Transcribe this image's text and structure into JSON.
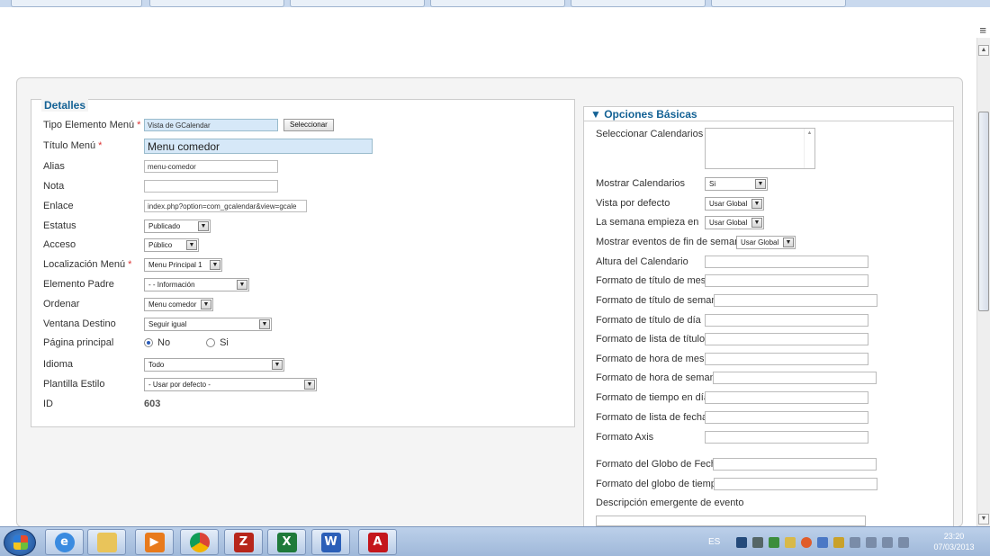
{
  "browser": {
    "menu_glyph": "≡"
  },
  "details": {
    "legend": "Detalles",
    "tipo_label": "Tipo Elemento Menú",
    "tipo_value": "Vista de GCalendar",
    "seleccionar_button": "Seleccionar",
    "titulo_label": "Título Menú",
    "titulo_value": "Menu comedor",
    "alias_label": "Alias",
    "alias_value": "menu-comedor",
    "nota_label": "Nota",
    "nota_value": "",
    "enlace_label": "Enlace",
    "enlace_value": "index.php?option=com_gcalendar&view=gcale",
    "estatus_label": "Estatus",
    "estatus_value": "Publicado",
    "acceso_label": "Acceso",
    "acceso_value": "Público",
    "localizacion_label": "Localización Menú",
    "localizacion_value": "Menu Principal 1",
    "padre_label": "Elemento Padre",
    "padre_value": "- - Información",
    "ordenar_label": "Ordenar",
    "ordenar_value": "Menu comedor",
    "ventana_label": "Ventana Destino",
    "ventana_value": "Seguir igual",
    "principal_label": "Página principal",
    "principal_no": "No",
    "principal_si": "Si",
    "principal_selected": "No",
    "idioma_label": "Idioma",
    "idioma_value": "Todo",
    "plantilla_label": "Plantilla Estilo",
    "plantilla_value": "- Usar por defecto -",
    "id_label": "ID",
    "id_value": "603",
    "required_mark": "*"
  },
  "options": {
    "title": "▼ Opciones Básicas",
    "calendarios_label": "Seleccionar Calendarios",
    "mostrar_cal_label": "Mostrar Calendarios",
    "mostrar_cal_value": "Si",
    "vista_label": "Vista por defecto",
    "vista_value": "Usar Global",
    "semana_label": "La semana empieza en",
    "semana_value": "Usar Global",
    "finde_label": "Mostrar eventos de fin de semana",
    "finde_value": "Usar Global",
    "altura_label": "Altura del Calendario",
    "titulo_mes_label": "Formato de título de mes",
    "titulo_semana_label": "Formato de título de semana",
    "titulo_dia_label": "Formato de título de día",
    "lista_titulo_label": "Formato de lista de título",
    "hora_mes_label": "Formato de hora de mes",
    "hora_semana_label": "Formato de hora de semana",
    "tiempo_dia_label": "Formato de tiempo en día",
    "lista_fecha_label": "Formato de lista de fecha",
    "axis_label": "Formato Axis",
    "globo_fecha_label": "Formato del Globo de Fecha",
    "globo_tiempo_label": "Formato del globo de tiempo",
    "descripcion_label": "Descripción emergente de evento"
  },
  "taskbar": {
    "lang": "ES",
    "time": "23:20",
    "date": "07/03/2013",
    "apps": [
      "internet-explorer",
      "file-explorer",
      "media-player",
      "chrome",
      "filezilla",
      "excel",
      "word",
      "acrobat"
    ]
  },
  "colors": {
    "accent": "#146295",
    "required": "#dd3333",
    "highlight_field": "#d6e8f8"
  }
}
